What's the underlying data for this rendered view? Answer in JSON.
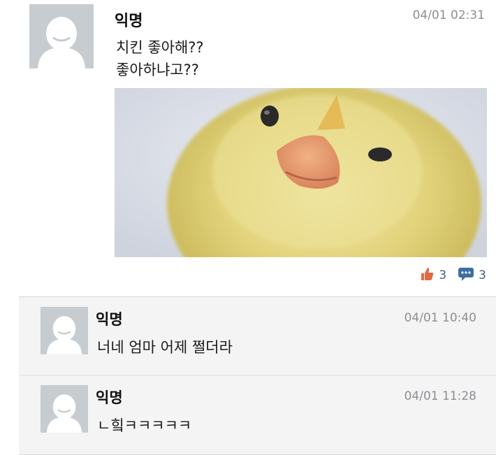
{
  "post": {
    "author": "익명",
    "timestamp": "04/01 02:31",
    "lines": [
      "치킨 좋아해??",
      "좋아하냐고??"
    ],
    "image_icon": "chick-photo",
    "likes": "3",
    "comments": "3",
    "like_icon": "thumbs-up-icon",
    "comment_icon": "speech-bubble-icon",
    "colors": {
      "like": "#e06a45",
      "comment": "#3d6fa3"
    }
  },
  "comments": [
    {
      "author": "익명",
      "timestamp": "04/01 10:40",
      "text": "너네 엄마 어제 쩔더라"
    },
    {
      "author": "익명",
      "timestamp": "04/01 11:28",
      "text": "ㄴ힠ㅋㅋㅋㅋㅋ"
    }
  ]
}
